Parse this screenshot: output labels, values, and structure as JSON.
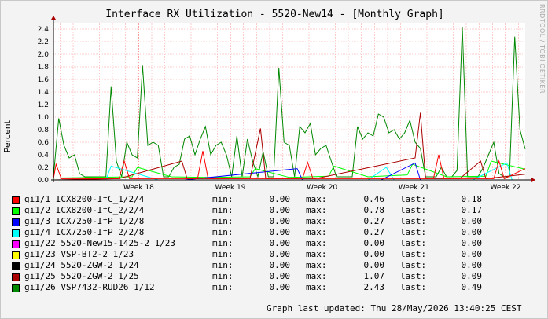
{
  "header": {
    "title": "Interface RX Utilization - 5520-New14 - [Monthly Graph]",
    "watermark": "RRDTOOL / TOBI OETIKER"
  },
  "footer": {
    "updated": "Graph last updated: Thu 28/May/2026 13:40:25 CEST"
  },
  "legend": [
    {
      "color": "#ff0000",
      "name": "gi1/1 ICX8200-IfC_1/2/4",
      "min_label": "min:",
      "min": "0.00",
      "max_label": "max:",
      "max": "0.46",
      "last_label": "last:",
      "last": "0.18"
    },
    {
      "color": "#00ff00",
      "name": "gi1/2 ICX8200-IfC_2/2/4",
      "min_label": "min:",
      "min": "0.00",
      "max_label": "max:",
      "max": "0.78",
      "last_label": "last:",
      "last": "0.17"
    },
    {
      "color": "#0000ff",
      "name": "gi1/3 ICX7250-IfP_1/2/8",
      "min_label": "min:",
      "min": "0.00",
      "max_label": "max:",
      "max": "0.27",
      "last_label": "last:",
      "last": "0.00"
    },
    {
      "color": "#00ffff",
      "name": "gi1/4 ICX7250-IfP_2/2/8",
      "min_label": "min:",
      "min": "0.00",
      "max_label": "max:",
      "max": "0.27",
      "last_label": "last:",
      "last": "0.00"
    },
    {
      "color": "#ff00ff",
      "name": "gi1/22 5520-New15-1425-2_1/23",
      "min_label": "min:",
      "min": "0.00",
      "max_label": "max:",
      "max": "0.00",
      "last_label": "last:",
      "last": "0.00"
    },
    {
      "color": "#ffff00",
      "name": "gi1/23 VSP-BT2-2_1/23",
      "min_label": "min:",
      "min": "0.00",
      "max_label": "max:",
      "max": "0.00",
      "last_label": "last:",
      "last": "0.00"
    },
    {
      "color": "#000000",
      "name": "gi1/24 5520-ZGW-2_1/24",
      "min_label": "min:",
      "min": "0.00",
      "max_label": "max:",
      "max": "0.00",
      "last_label": "last:",
      "last": "0.00"
    },
    {
      "color": "#aa0000",
      "name": "gi1/25 5520-ZGW-2_1/25",
      "min_label": "min:",
      "min": "0.00",
      "max_label": "max:",
      "max": "1.07",
      "last_label": "last:",
      "last": "0.09"
    },
    {
      "color": "#008800",
      "name": "gi1/26 VSP7432-RUD26_1/12",
      "min_label": "min:",
      "min": "0.00",
      "max_label": "max:",
      "max": "2.43",
      "last_label": "last:",
      "last": "0.49"
    }
  ],
  "chart_data": {
    "type": "line",
    "title": "Interface RX Utilization - 5520-New14 - [Monthly Graph]",
    "ylabel": "Percent",
    "ylim": [
      0,
      2.5
    ],
    "yticks": [
      0.0,
      0.2,
      0.4,
      0.6,
      0.8,
      1.0,
      1.2,
      1.4,
      1.6,
      1.8,
      2.0,
      2.2,
      2.4
    ],
    "ytick_labels": [
      "0.0",
      "0.2",
      "0.4",
      "0.6",
      "0.8",
      "1.0",
      "1.2",
      "1.4",
      "1.6",
      "1.8",
      "2.0",
      "2.2",
      "2.4"
    ],
    "xlim": [
      0,
      36
    ],
    "xticks": [
      {
        "x": 6.5,
        "label": "Week 18"
      },
      {
        "x": 13.5,
        "label": "Week 19"
      },
      {
        "x": 20.5,
        "label": "Week 20"
      },
      {
        "x": 27.5,
        "label": "Week 21"
      },
      {
        "x": 34.5,
        "label": "Week 22"
      }
    ],
    "grid": true,
    "series": [
      {
        "name": "gi1/26 VSP7432-RUD26_1/12",
        "color": "#008800",
        "x": [
          0,
          0.4,
          0.8,
          1.2,
          1.6,
          2.0,
          2.4,
          2.8,
          3.2,
          3.6,
          4.0,
          4.4,
          4.8,
          5.2,
          5.6,
          6.0,
          6.4,
          6.8,
          7.2,
          7.6,
          8.0,
          8.4,
          8.8,
          9.2,
          9.6,
          10.0,
          10.4,
          10.8,
          11.2,
          11.6,
          12.0,
          12.4,
          12.8,
          13.2,
          13.6,
          14.0,
          14.4,
          14.8,
          15.2,
          15.6,
          16.0,
          16.4,
          16.8,
          17.2,
          17.6,
          18.0,
          18.4,
          18.8,
          19.2,
          19.6,
          20.0,
          20.4,
          20.8,
          21.2,
          21.6,
          22.0,
          22.4,
          22.8,
          23.2,
          23.6,
          24.0,
          24.4,
          24.8,
          25.2,
          25.6,
          26.0,
          26.4,
          26.8,
          27.2,
          27.6,
          28.0,
          28.4,
          28.8,
          29.2,
          29.6,
          30.0,
          30.4,
          30.8,
          31.2,
          31.6,
          32.0,
          32.4,
          32.8,
          33.2,
          33.6,
          34.0,
          34.4,
          34.8,
          35.2,
          35.6,
          36.0
        ],
        "y": [
          0.05,
          0.98,
          0.55,
          0.35,
          0.4,
          0.1,
          0.05,
          0.05,
          0.05,
          0.05,
          0.05,
          1.48,
          0.3,
          0.05,
          0.6,
          0.4,
          0.35,
          1.82,
          0.55,
          0.6,
          0.55,
          0.05,
          0.05,
          0.2,
          0.25,
          0.65,
          0.7,
          0.4,
          0.65,
          0.85,
          0.4,
          0.55,
          0.6,
          0.4,
          0.05,
          0.7,
          0.05,
          0.65,
          0.3,
          0.05,
          0.45,
          0.05,
          0.05,
          1.78,
          0.6,
          0.55,
          0.05,
          0.85,
          0.75,
          0.9,
          0.4,
          0.5,
          0.55,
          0.3,
          0.05,
          0.05,
          0.05,
          0.05,
          0.85,
          0.65,
          0.75,
          0.7,
          1.05,
          1.0,
          0.75,
          0.8,
          0.65,
          0.75,
          0.95,
          0.6,
          0.5,
          0.05,
          0.05,
          0.05,
          0.2,
          0.05,
          0.05,
          0.15,
          2.43,
          0.05,
          0.05,
          0.05,
          0.2,
          0.4,
          0.6,
          0.1,
          0.05,
          0.05,
          2.28,
          0.8,
          0.49
        ]
      },
      {
        "name": "gi1/2 ICX8200-IfC_2/2/4",
        "color": "#00ff00",
        "x": [
          0,
          3,
          6,
          6.4,
          9,
          12,
          15,
          15.4,
          18,
          21,
          21.4,
          24,
          27,
          27.4,
          30,
          33,
          33.4,
          36
        ],
        "y": [
          0.03,
          0.04,
          0.05,
          0.2,
          0.05,
          0.04,
          0.05,
          0.18,
          0.04,
          0.06,
          0.22,
          0.05,
          0.08,
          0.25,
          0.05,
          0.06,
          0.3,
          0.17
        ]
      },
      {
        "name": "gi1/4 ICX7250-IfP_2/2/8",
        "color": "#00ffff",
        "x": [
          0,
          4,
          4.4,
          8,
          12,
          16,
          20,
          24,
          25.4,
          26,
          28,
          32,
          34.6,
          35,
          36
        ],
        "y": [
          0.0,
          0.0,
          0.22,
          0.0,
          0.0,
          0.0,
          0.0,
          0.0,
          0.2,
          0.0,
          0.0,
          0.0,
          0.27,
          0.0,
          0.0
        ]
      },
      {
        "name": "gi1/3 ICX7250-IfP_1/2/8",
        "color": "#0000ff",
        "x": [
          0,
          10,
          18.6,
          19,
          25,
          27.6,
          28,
          36
        ],
        "y": [
          0.0,
          0.0,
          0.18,
          0.0,
          0.0,
          0.27,
          0.0,
          0.0
        ]
      },
      {
        "name": "gi1/25 5520-ZGW-2_1/25",
        "color": "#aa0000",
        "x": [
          0,
          5,
          9.8,
          10.2,
          15,
          15.8,
          16.2,
          20,
          27.6,
          28,
          28.4,
          31,
          32.6,
          33,
          36
        ],
        "y": [
          0.0,
          0.02,
          0.3,
          0.02,
          0.02,
          0.82,
          0.02,
          0.02,
          0.35,
          1.07,
          0.02,
          0.02,
          0.3,
          0.02,
          0.09
        ]
      },
      {
        "name": "gi1/1 ICX8200-IfC_1/2/4",
        "color": "#ff0000",
        "x": [
          0,
          0.2,
          0.6,
          5,
          5.4,
          5.8,
          11,
          11.4,
          11.8,
          19,
          19.4,
          19.8,
          29,
          29.4,
          29.8,
          33.6,
          34,
          34.4,
          36
        ],
        "y": [
          0.02,
          0.25,
          0.02,
          0.02,
          0.3,
          0.02,
          0.02,
          0.46,
          0.02,
          0.02,
          0.28,
          0.02,
          0.02,
          0.4,
          0.02,
          0.02,
          0.3,
          0.02,
          0.18
        ]
      }
    ]
  }
}
